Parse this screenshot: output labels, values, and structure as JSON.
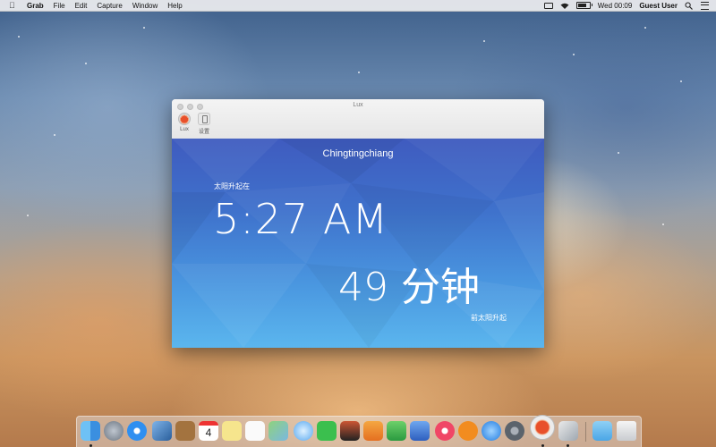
{
  "menubar": {
    "app_name": "Grab",
    "menus": [
      "File",
      "Edit",
      "Capture",
      "Window",
      "Help"
    ],
    "clock": "Wed 00:09",
    "user": "Guest User",
    "icons": [
      "apple-icon",
      "airplay-icon",
      "wifi-icon",
      "battery-icon",
      "search-icon",
      "notification-list-icon"
    ]
  },
  "window": {
    "title": "Lux",
    "toolbar": {
      "lux_label": "Lux",
      "settings_label": "设置"
    },
    "content": {
      "city": "Chingtingchiang",
      "sunrise_label": "太阳升起在",
      "sunrise_time": "5:27 AM",
      "countdown": "49 分钟",
      "countdown_label": "前太阳升起"
    }
  },
  "dock": {
    "icons": [
      "finder-icon",
      "launchpad-icon",
      "safari-icon",
      "mail-icon",
      "contacts-icon",
      "calendar-icon",
      "notes-icon",
      "reminders-icon",
      "maps-icon",
      "messages-icon",
      "facetime-icon",
      "photo-booth-icon",
      "pages-icon",
      "numbers-icon",
      "keynote-icon",
      "itunes-icon",
      "ibooks-icon",
      "app-store-icon",
      "system-preferences-icon",
      "lux-icon",
      "preview-icon",
      "downloads-folder-icon",
      "trash-icon"
    ],
    "calendar_day": "4"
  }
}
